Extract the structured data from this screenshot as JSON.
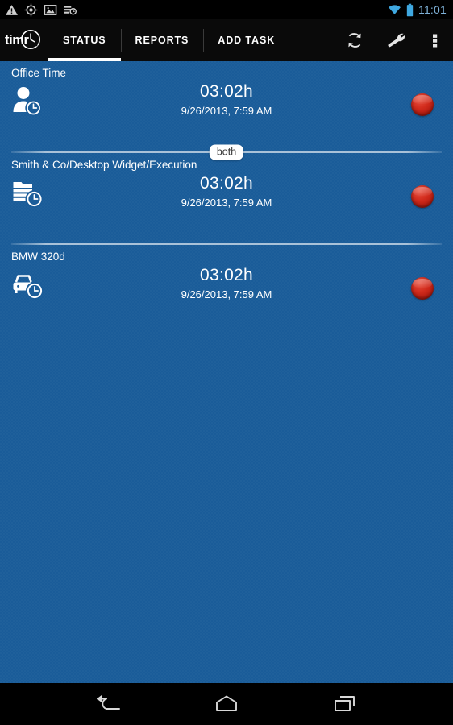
{
  "statusbar": {
    "time": "11:01",
    "left_icons": [
      "warning-triangle-icon",
      "location-crosshair-icon",
      "photo-icon",
      "screenshot-icon"
    ],
    "right_icons": [
      "wifi-icon",
      "battery-icon"
    ],
    "clock_color": "#7FB2D9"
  },
  "actionbar": {
    "brand": "timr",
    "tabs": [
      {
        "label": "STATUS",
        "active": true
      },
      {
        "label": "REPORTS",
        "active": false
      },
      {
        "label": "ADD TASK",
        "active": false
      }
    ],
    "actions": [
      "refresh-icon",
      "wrench-icon",
      "overflow-menu-icon"
    ]
  },
  "list": {
    "items": [
      {
        "title": "Office Time",
        "icon": "person-clock-icon",
        "duration": "03:02h",
        "timestamp": "9/26/2013, 7:59 AM",
        "button": "stop-recording-button"
      },
      {
        "title": "Smith & Co/Desktop Widget/Execution",
        "icon": "task-clock-icon",
        "duration": "03:02h",
        "timestamp": "9/26/2013, 7:59 AM",
        "button": "stop-recording-button"
      },
      {
        "title": "BMW 320d",
        "icon": "car-clock-icon",
        "duration": "03:02h",
        "timestamp": "9/26/2013, 7:59 AM",
        "button": "stop-recording-button"
      }
    ],
    "divider_label": "both"
  },
  "navbar": {
    "buttons": [
      "back-icon",
      "home-icon",
      "recent-apps-icon"
    ]
  },
  "colors": {
    "content_background": "#1A5C99",
    "actionbar_background": "#0A0A0A",
    "accent_red": "#D12B1C",
    "text_primary": "#FFFFFF"
  }
}
